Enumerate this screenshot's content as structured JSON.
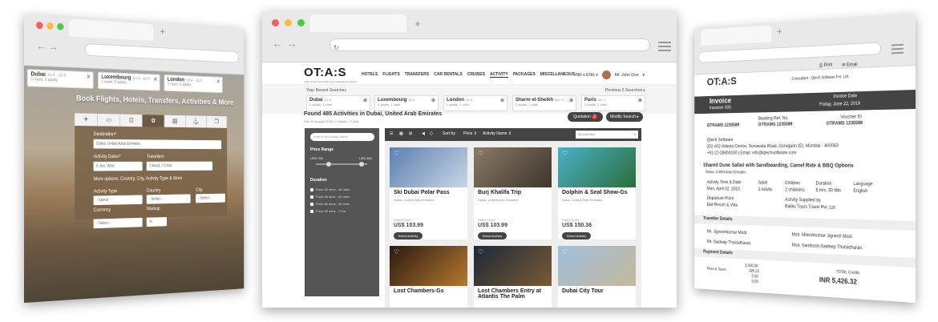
{
  "left_window": {
    "tabs": [
      {
        "city": "Dubai",
        "dates": "Jul 4 - Jul 5",
        "sub": "1 room, 2 adults"
      },
      {
        "city": "Luxembourg",
        "dates": "Jul 4 - Jul 5",
        "sub": "1 room, 2 adults"
      },
      {
        "city": "London",
        "dates": "Jul 4 - Jul 5",
        "sub": "1 room, 2 adults"
      }
    ],
    "hero_title": "Book Flights, Hotels, Transfers, Activities & More",
    "destination_label": "Destination*",
    "destination_value": "Dubai, United Arab Emirates",
    "activity_dates_label": "Activity Dates*",
    "activity_dates_value": "6 Jun, Wed",
    "travellers_label": "Travellers",
    "travellers_value": "2 Adult, 0 Child",
    "more_options": "More options: Country, City, Activity Type & More",
    "activity_type_label": "Activity Type",
    "activity_type_value": "- Select -",
    "country_label": "Country",
    "country_value": "- Select -",
    "city_label": "City",
    "city_value": "- Select -",
    "currency_label": "Currency",
    "currency_value": "- Select -",
    "markup_label": "Markup",
    "markup_value": "%"
  },
  "center_window": {
    "logo": "OT:A:S",
    "logo_sub": "online travel reservation and management system",
    "nav": [
      "HOTELS",
      "FLIGHTS",
      "TRANSFERS",
      "CAR RENTALS",
      "CRUISES",
      "ACTIVITY",
      "PACKAGES",
      "MISCELLANEOUS"
    ],
    "lang": "INR ▾  ENG ▾",
    "user_name": "Mr. John Doe",
    "recent_label": "Your Recent Searches",
    "previous_label": "Previous 5 Searches ▸",
    "recent": [
      {
        "city": "Dubai",
        "dates": "Jul 6",
        "sub": "2 adults, 1 child"
      },
      {
        "city": "Luxembourg",
        "dates": "Jul 6",
        "sub": "2 adults, 1 child"
      },
      {
        "city": "London",
        "dates": "Jul 6",
        "sub": "2 adults, 1 child"
      },
      {
        "city": "Sharm el-Sheikh",
        "dates": "Nov 27",
        "sub": "2 adults, 1 child"
      },
      {
        "city": "Paris",
        "dates": "Dec 2",
        "sub": "2 adults, 1 child"
      }
    ],
    "found": "Found 485 Activities in Dubai, United Arab Emirates",
    "found_sub": "Sat, 30 August 2018 | 2 Adults, 1 Child",
    "quotation": "Quotation",
    "quotation_count": "3",
    "modify": "Modify Search ▸",
    "search_placeholder": "Search by Activity name",
    "price_range": "Price Range",
    "price_min": "USD 300",
    "price_max": "USD 800",
    "price_low": 0.2,
    "price_high": 0.85,
    "duration": "Duration",
    "durations": [
      "From 30 mins - 45 mins",
      "From 45 mins - 60 mins",
      "From 60 mins - 90 mins",
      "From 90 mins - 2 hrs"
    ],
    "sort_by": "Sort by",
    "sort_price": "Price ⇕",
    "sort_name": "Activity Name ⇕",
    "all_activities": "All Activities",
    "cards": [
      {
        "name": "Ski Dubai Polar Pass",
        "loc": "Dubai, United Arab Emirates",
        "start": "Starts From",
        "price": "US$ 103.99",
        "btn": "Select Activity",
        "c1": "#5c7fb3",
        "c2": "#c9d6e4"
      },
      {
        "name": "Burj Khalifa Trip",
        "loc": "Dubai, United Arab Emirates",
        "start": "Starts From",
        "price": "US$ 103.99",
        "btn": "Select Activity",
        "c1": "#8a7a68",
        "c2": "#3d342b"
      },
      {
        "name": "Dolphin & Seal Show-Gs",
        "loc": "Dubai, United Arab Emirates",
        "start": "Starts From",
        "price": "US$ 150.36",
        "btn": "Select Activity",
        "c1": "#4ab1c5",
        "c2": "#2b6d3d"
      },
      {
        "name": "Lost Chambers-Gs",
        "loc": "",
        "start": "",
        "price": "",
        "btn": "",
        "c1": "#2a1a10",
        "c2": "#b7782f"
      },
      {
        "name": "Lost Chambers Entry at Atlantis The Palm",
        "loc": "",
        "start": "",
        "price": "",
        "btn": "",
        "c1": "#1d2838",
        "c2": "#7a5a34"
      },
      {
        "name": "Dubai City Tour",
        "loc": "",
        "start": "",
        "price": "",
        "btn": "",
        "c1": "#9fc0dc",
        "c2": "#c6b79c"
      }
    ]
  },
  "right_window": {
    "print": "Print",
    "email": "Email",
    "logo": "OT:A:S",
    "consultant": "Consultant : Qtech Software Pvt. Ltd.",
    "invoice_title": "Invoice",
    "invoice_no": "Invoice# 005",
    "invoice_date_label": "Invoice Date",
    "invoice_date": "Friday, June 22, 2018",
    "booking_ref_label": "Booking Ref. No.",
    "booking_ref": "OTRAMS 1235589",
    "ref1": "OTRAMS 1235589",
    "voucher_label": "Voucher ID",
    "voucher": "OTRAMS 1235589",
    "company": "Qtech Software",
    "address": "302-402 Atlanta Centre, Sonawala Road, Goregaon (E), Mumbai - 400063",
    "phone": "+91-22-26850030 | Email: info@qtechsoftware.com",
    "activity": "Shared Dune Safari with Sandboarding, Camel Ride & BBQ Options",
    "activity_loc": "Dubai, United Arab Emirates",
    "h_time": "Activity Time & Date",
    "v_time": "Mon, April 02, 2019",
    "h_adult": "Adult",
    "v_adult": "2 Adults",
    "h_children": "Children",
    "v_children": "2 childrens",
    "h_duration": "Duration",
    "v_duration": "5 Hrs. 30 Min",
    "h_lang": "Language",
    "v_lang": "English",
    "h_dep": "Departure Point",
    "v_dep": "Bali Resort & Villa",
    "h_sup": "Activity Supplied by",
    "v_sup": "Baliku Tours Travel Pvt. Ltd",
    "traveller_title": "Traveller Details",
    "t1": "Mr. Jigneshkumar Modi.",
    "t2": "Mstr. Miteshkumar Jignesh Modi.",
    "t3": "Mstr. Santhosh Saideep Thulsidharan.",
    "t4": "Mr. Saideep Thulsidharan.",
    "payment_title": "Payment Details",
    "amt1": "5,000.00",
    "amt2": "426.32",
    "amt3": "0.00",
    "amt4": "0.00",
    "fees": "Fees & Taxes",
    "total_label": "TOTAL Credits",
    "total": "INR 5,426.32"
  }
}
